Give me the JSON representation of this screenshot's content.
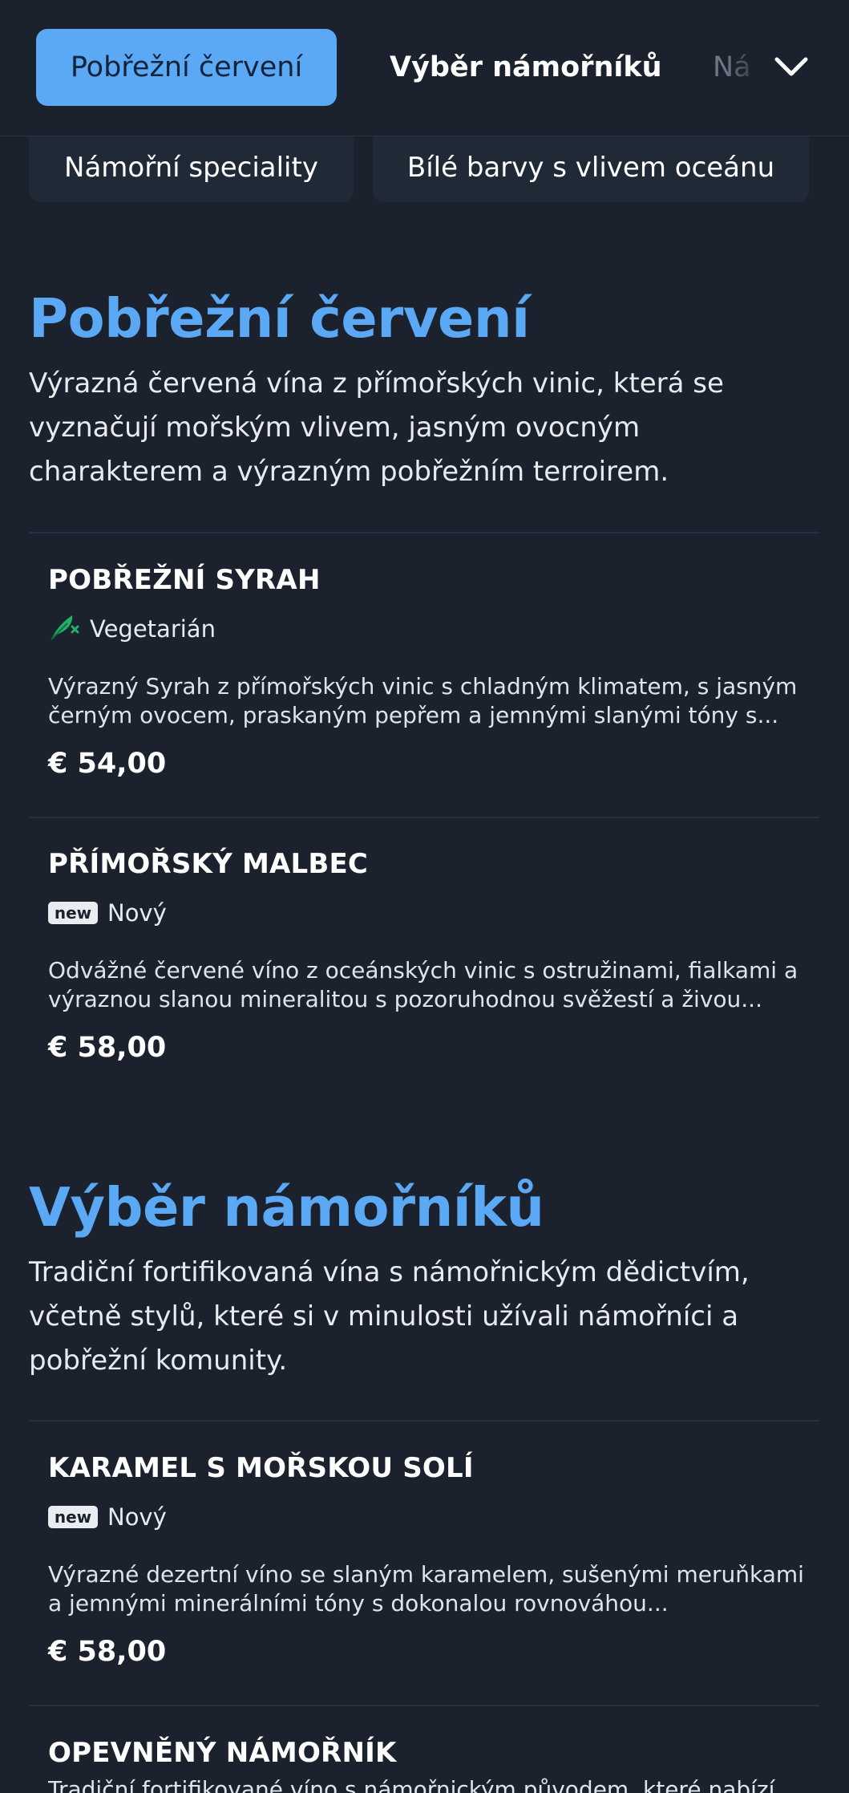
{
  "nav": {
    "tabs": [
      {
        "label": "Pobřežní červení",
        "active": true
      },
      {
        "label": "Výběr námořníků",
        "active": false
      },
      {
        "label": "Ná",
        "active": false
      }
    ],
    "more_icon": "chevron-down-icon",
    "chips": [
      {
        "label": "Námořní speciality"
      },
      {
        "label": "Bílé barvy s vlivem oceánu"
      }
    ]
  },
  "sections": [
    {
      "title": "Pobřežní červení",
      "description": "Výrazná červená vína z přímořských vinic, která se vyznačují mořským vlivem, jasným ovocným charakterem a výrazným pobřežním terroirem.",
      "items": [
        {
          "name": "POBŘEŽNÍ SYRAH",
          "tag_icon": "vegetarian-leaf-icon",
          "tag_label": "Vegetarián",
          "description": "Výrazný Syrah z přímořských vinic s chladným klimatem, s jasným černým ovocem, praskaným pepřem a jemnými slanými tóny s...",
          "price": "€ 54,00"
        },
        {
          "name": "PŘÍMOŘSKÝ MALBEC",
          "tag_badge": "new",
          "tag_label": "Nový",
          "description": "Odvážné červené víno z oceánských vinic s ostružinami, fialkami a výraznou slanou mineralitou s pozoruhodnou svěžestí a živou...",
          "price": "€ 58,00"
        }
      ]
    },
    {
      "title": "Výběr námořníků",
      "description": "Tradiční fortifikovaná vína s námořnickým dědictvím, včetně stylů, které si v minulosti užívali námořníci a pobřežní komunity.",
      "items": [
        {
          "name": "KARAMEL S MOŘSKOU SOLÍ",
          "tag_badge": "new",
          "tag_label": "Nový",
          "description": "Výrazné dezertní víno se slaným karamelem, sušenými meruňkami a jemnými minerálními tóny s dokonalou rovnováhou...",
          "price": "€ 58,00"
        },
        {
          "name": "OPEVNĚNÝ NÁMOŘNÍK",
          "description": "Tradiční fortifikované víno s námořnickým původem, které nabízí"
        }
      ]
    }
  ],
  "colors": {
    "background": "#1b222d",
    "accent": "#5ba8f5",
    "card": "#202a37",
    "vegetarian_icon": "#1fb36a"
  }
}
